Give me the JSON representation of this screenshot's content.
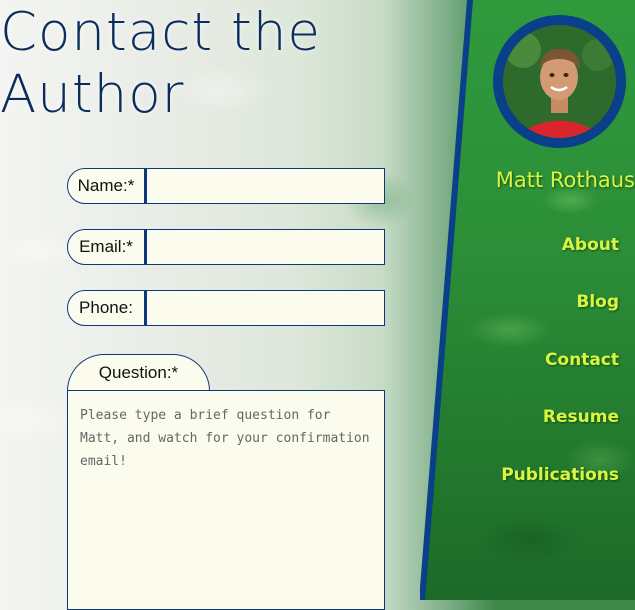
{
  "page": {
    "title_line1": "Contact the",
    "title_line2": "Author"
  },
  "form": {
    "name_label": "Name:*",
    "name_value": "",
    "email_label": "Email:*",
    "email_value": "",
    "phone_label": "Phone:",
    "phone_value": "",
    "question_label": "Question:*",
    "question_placeholder": "Please type a brief question for Matt, and watch for your confirmation email!"
  },
  "sidebar": {
    "author_name": "Matt Rothaus",
    "nav": [
      {
        "label": "About"
      },
      {
        "label": "Blog"
      },
      {
        "label": "Contact"
      },
      {
        "label": "Resume"
      },
      {
        "label": "Publications"
      }
    ]
  },
  "colors": {
    "title": "#0b2d5e",
    "nav_text": "#d9f542",
    "sidebar_border": "#0a3f8a",
    "field_bg": "#fbfcee"
  }
}
